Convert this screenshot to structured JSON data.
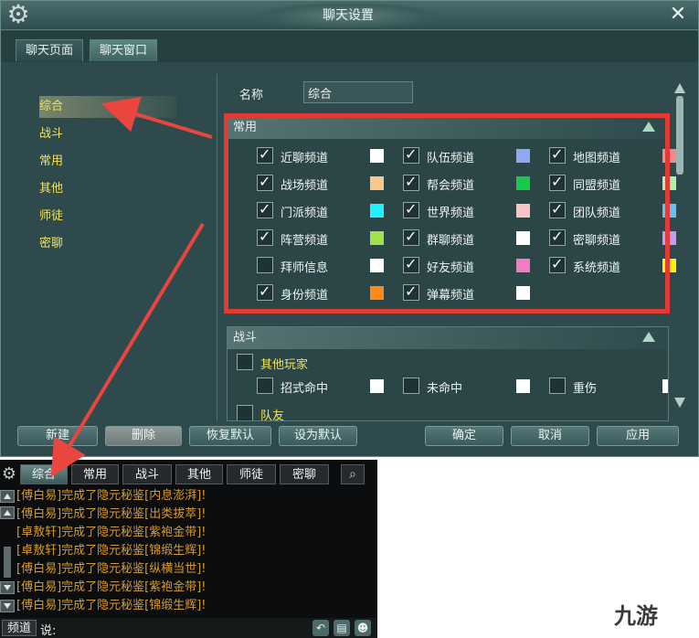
{
  "window": {
    "title": "聊天设置",
    "close": "✕"
  },
  "tabs": [
    {
      "label": "聊天页面"
    },
    {
      "label": "聊天窗口"
    }
  ],
  "categories": [
    {
      "label": "综合"
    },
    {
      "label": "战斗"
    },
    {
      "label": "常用"
    },
    {
      "label": "其他"
    },
    {
      "label": "师徒"
    },
    {
      "label": "密聊"
    }
  ],
  "name_field": {
    "label": "名称",
    "value": "综合"
  },
  "common_section": {
    "title": "常用",
    "channels": [
      {
        "label": "近聊频道",
        "checked": true,
        "color": "#ffffff"
      },
      {
        "label": "队伍频道",
        "checked": true,
        "color": "#8fa8ef"
      },
      {
        "label": "地图频道",
        "checked": true,
        "color": "#f08b8b"
      },
      {
        "label": "战场频道",
        "checked": true,
        "color": "#f9c78c"
      },
      {
        "label": "帮会频道",
        "checked": true,
        "color": "#19c94b"
      },
      {
        "label": "同盟频道",
        "checked": true,
        "color": "#b2f0a6"
      },
      {
        "label": "门派频道",
        "checked": true,
        "color": "#22f0ff"
      },
      {
        "label": "世界频道",
        "checked": true,
        "color": "#f8c5c5"
      },
      {
        "label": "团队频道",
        "checked": true,
        "color": "#66bff5"
      },
      {
        "label": "阵营频道",
        "checked": true,
        "color": "#9fe24a"
      },
      {
        "label": "群聊频道",
        "checked": true,
        "color": "#ffffff"
      },
      {
        "label": "密聊频道",
        "checked": true,
        "color": "#c59af0"
      },
      {
        "label": "拜师信息",
        "checked": false,
        "color": "#ffffff"
      },
      {
        "label": "好友频道",
        "checked": true,
        "color": "#f07cc3"
      },
      {
        "label": "系统频道",
        "checked": true,
        "color": "#fff200"
      },
      {
        "label": "身份频道",
        "checked": true,
        "color": "#ff8a1a"
      },
      {
        "label": "弹幕频道",
        "checked": true,
        "color": "#ffffff"
      }
    ]
  },
  "combat_section": {
    "title": "战斗",
    "groups": [
      {
        "label": "其他玩家",
        "checked": false
      },
      {
        "label": "队友",
        "checked": false
      }
    ],
    "channels": [
      {
        "label": "招式命中",
        "checked": false,
        "color": "#ffffff"
      },
      {
        "label": "未命中",
        "checked": false,
        "color": "#ffffff"
      },
      {
        "label": "重伤",
        "checked": false,
        "color": "#ffffff"
      }
    ]
  },
  "buttons": {
    "new": "新建",
    "delete": "删除",
    "restore_default": "恢复默认",
    "set_default": "设为默认",
    "ok": "确定",
    "cancel": "取消",
    "apply": "应用"
  },
  "chat": {
    "tabs": [
      {
        "label": "综合"
      },
      {
        "label": "常用"
      },
      {
        "label": "战斗"
      },
      {
        "label": "其他"
      },
      {
        "label": "师徒"
      },
      {
        "label": "密聊"
      }
    ],
    "lines": [
      "[傅白易]完成了隐元秘鉴[内息澎湃]!",
      "[傅白易]完成了隐元秘鉴[出类拔萃]!",
      "[卓敖轩]完成了隐元秘鉴[紫袍金带]!",
      "[卓敖轩]完成了隐元秘鉴[锦缎生辉]!",
      "[傅白易]完成了隐元秘鉴[纵横当世]!",
      "[傅白易]完成了隐元秘鉴[紫袍金带]!",
      "[傅白易]完成了隐元秘鉴[锦缎生辉]!"
    ],
    "channel_label": "频道",
    "say_label": "说:",
    "input_value": "",
    "icons": [
      "undo-icon",
      "message-icon",
      "emoji-icon"
    ]
  },
  "watermark": "九游",
  "colors": {
    "accent_yellow": "#f3e35a",
    "chat_text": "#d79a2a",
    "highlight_red": "#e23b35",
    "panel_bg": "#2e4a4c"
  }
}
